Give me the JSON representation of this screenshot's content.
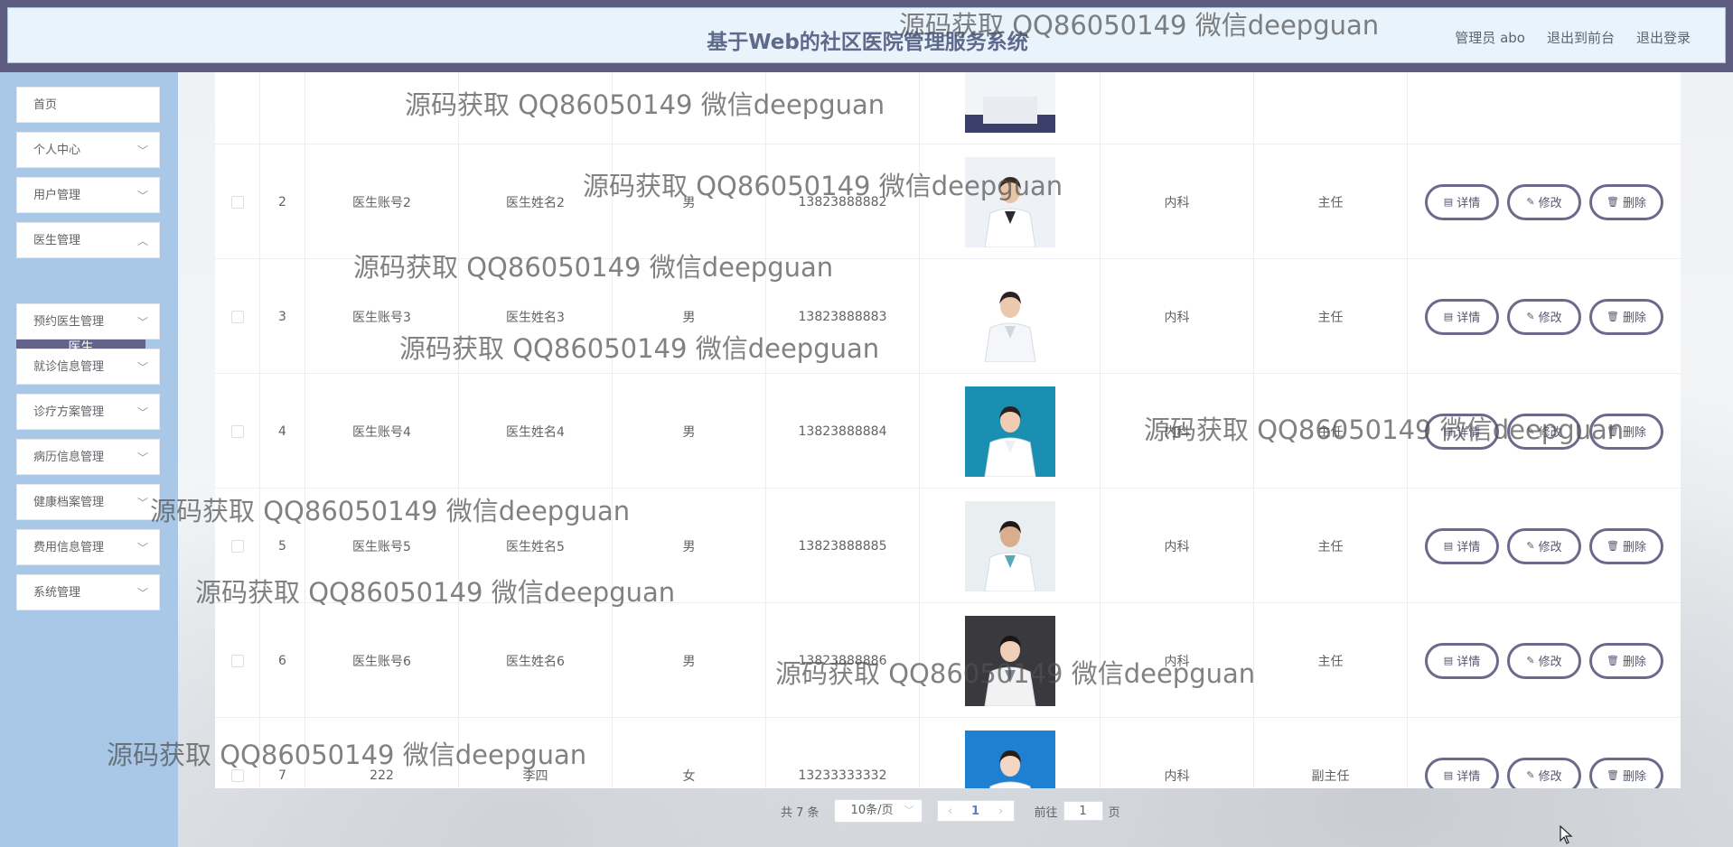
{
  "header": {
    "title": "基于Web的社区医院管理服务系统",
    "admin": "管理员 abo",
    "front": "退出到前台",
    "logout": "退出登录"
  },
  "sidebar": {
    "items": [
      {
        "label": "首页",
        "chevron": false
      },
      {
        "label": "个人中心",
        "chevron": true
      },
      {
        "label": "用户管理",
        "chevron": true
      },
      {
        "label": "医生管理",
        "chevron": true
      },
      {
        "label": "预约医生管理",
        "chevron": true
      },
      {
        "label": "就诊信息管理",
        "chevron": true
      },
      {
        "label": "诊疗方案管理",
        "chevron": true
      },
      {
        "label": "病历信息管理",
        "chevron": true
      },
      {
        "label": "健康档案管理",
        "chevron": true
      },
      {
        "label": "费用信息管理",
        "chevron": true
      },
      {
        "label": "系统管理",
        "chevron": true
      }
    ],
    "active_sub": "医生"
  },
  "table": {
    "rows": [
      {
        "index": "2",
        "account": "医生账号2",
        "name": "医生姓名2",
        "gender": "男",
        "phone": "13823888882",
        "dept": "内科",
        "title": "主任",
        "photo": "doctor-photo-2"
      },
      {
        "index": "3",
        "account": "医生账号3",
        "name": "医生姓名3",
        "gender": "男",
        "phone": "13823888883",
        "dept": "内科",
        "title": "主任",
        "photo": "doctor-photo-3"
      },
      {
        "index": "4",
        "account": "医生账号4",
        "name": "医生姓名4",
        "gender": "男",
        "phone": "13823888884",
        "dept": "内科",
        "title": "主任",
        "photo": "doctor-photo-4"
      },
      {
        "index": "5",
        "account": "医生账号5",
        "name": "医生姓名5",
        "gender": "男",
        "phone": "13823888885",
        "dept": "内科",
        "title": "主任",
        "photo": "doctor-photo-5"
      },
      {
        "index": "6",
        "account": "医生账号6",
        "name": "医生姓名6",
        "gender": "男",
        "phone": "13823888886",
        "dept": "内科",
        "title": "主任",
        "photo": "doctor-photo-6"
      },
      {
        "index": "7",
        "account": "222",
        "name": "李四",
        "gender": "女",
        "phone": "13233333332",
        "dept": "内科",
        "title": "副主任",
        "photo": "doctor-photo-7"
      }
    ],
    "actions": {
      "detail": "详情",
      "edit": "修改",
      "delete": "删除"
    }
  },
  "pagination": {
    "total": "共 7 条",
    "page_size": "10条/页",
    "current_page": "1",
    "goto_label": "前往",
    "goto_value": "1",
    "page_suffix": "页"
  },
  "watermark": "源码获取 QQ86050149 微信deepguan",
  "colors": {
    "header_bar": "#5e5d80",
    "header_bg": "#e8f3fb",
    "sidebar_bg": "#a9c8e8",
    "active_sub": "#64648a",
    "button_border": "#6b6a8c"
  }
}
